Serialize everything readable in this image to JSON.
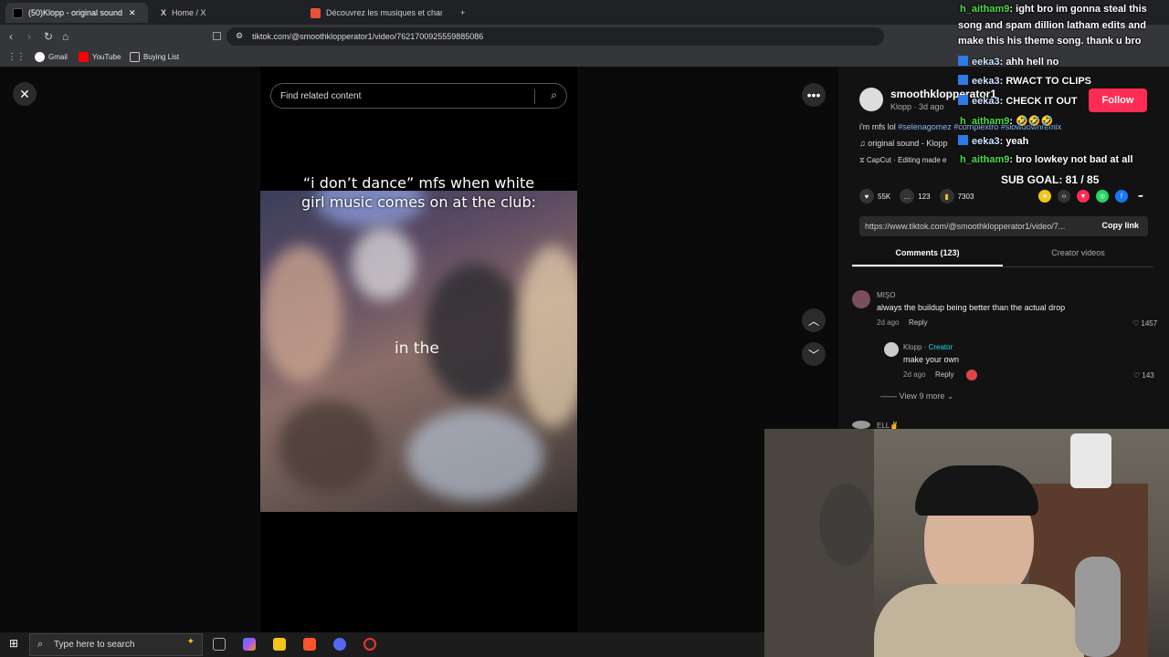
{
  "browser": {
    "tabs": [
      {
        "label": "(50)Klopp - original sound | T",
        "active": true
      },
      {
        "label": "Home / X",
        "active": false
      },
      {
        "label": "Découvrez les musiques et chansons",
        "active": false
      }
    ],
    "new_tab": "+",
    "url": "tiktok.com/@smoothklopperator1/video/7621700925559885086",
    "bookmarks": [
      "Gmail",
      "YouTube",
      "Buying List"
    ]
  },
  "video": {
    "search_placeholder": "Find related content",
    "caption": "“i don’t dance” mfs when white girl music comes on at the club:",
    "lyric": "in the"
  },
  "post": {
    "username": "smoothklopperator1",
    "meta": "Klopp · 3d ago",
    "follow_label": "Follow",
    "desc_text": "i'm mfs lol ",
    "desc_tags": "#selenagomez #complextro #slowdownremix",
    "sound": "original sound - Klopp",
    "capcut": "CapCut · Editing made e",
    "likes": "55K",
    "comments_count": "123",
    "saves": "7303",
    "link": "https://www.tiktok.com/@smoothklopperator1/video/7...",
    "copy_label": "Copy link",
    "tab_comments": "Comments (123)",
    "tab_creator": "Creator videos"
  },
  "comments": [
    {
      "author": "MIŞO",
      "text": "always the buildup being better than the actual drop",
      "age": "2d ago",
      "reply": "Reply",
      "likes": "1457"
    },
    {
      "author": "Klopp",
      "creator_tag": "· Creator",
      "text": "make your own",
      "age": "2d ago",
      "reply": "Reply",
      "likes": "143"
    },
    {
      "author": "ELL✌"
    }
  ],
  "view_more": "View 9 more",
  "chat": [
    {
      "nick": "h_aitham9",
      "msg": ": ight bro im gonna steal this"
    },
    {
      "nick": "",
      "msg": "song and spam dillion latham edits and"
    },
    {
      "nick": "",
      "msg": "make this his theme song. thank u bro"
    },
    {
      "nick": "eeka3",
      "msg": ": ahh hell no"
    },
    {
      "nick": "eeka3",
      "msg": ": RWACT TO CLIPS"
    },
    {
      "nick": "eeka3",
      "msg": ": CHECK IT OUT"
    },
    {
      "nick": "h_aitham9",
      "msg": ": 🤣🤣🤣"
    },
    {
      "nick": "eeka3",
      "msg": ": yeah"
    },
    {
      "nick": "h_aitham9",
      "msg": ": bro lowkey not bad at all"
    }
  ],
  "sub_goal": "SUB GOAL: 81 / 85",
  "taskbar": {
    "search_placeholder": "Type here to search"
  },
  "colors": {
    "accent": "#fe2c55",
    "chat_nick_green": "#4ade4a",
    "chat_badge": "#2d7be6"
  }
}
